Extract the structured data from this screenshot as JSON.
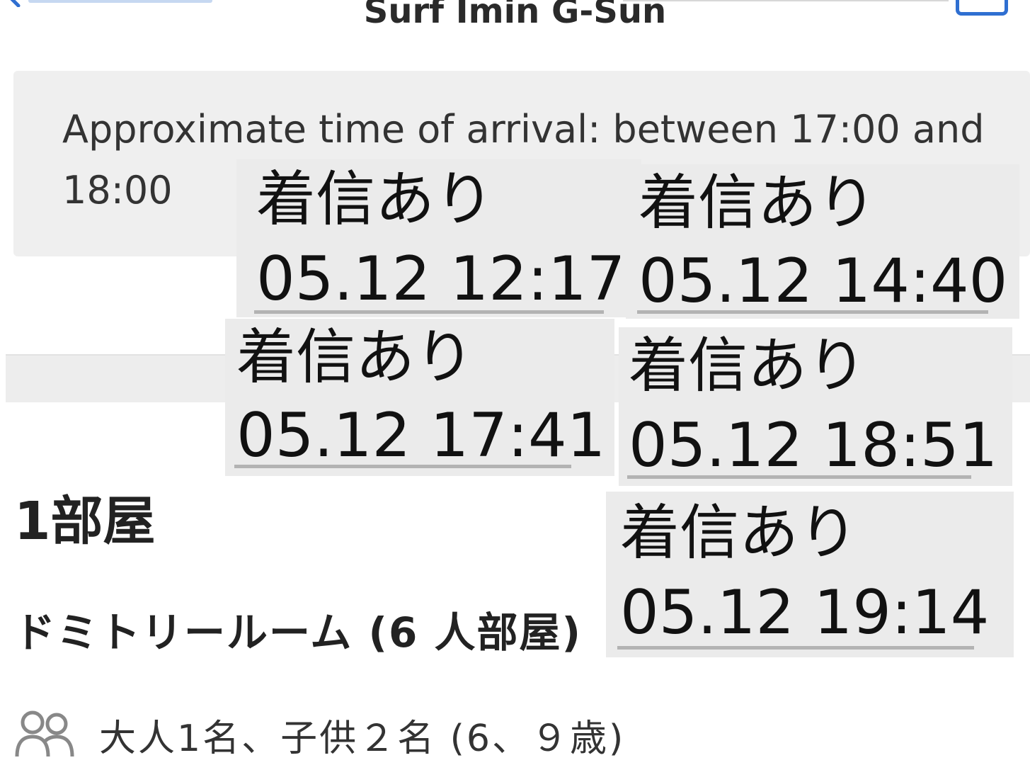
{
  "header": {
    "title": "Surf Imin G-Sun",
    "back_icon": "chevron-left-icon",
    "corner_icon": "compose-icon",
    "accent_color": "#2f6fd1"
  },
  "arrival": {
    "text": "Approximate time of arrival: between 17:00 and 18:00"
  },
  "room": {
    "count_label": "1部屋",
    "type_label": "ドミトリールーム (6 人部屋)",
    "guests_icon": "people-icon",
    "guests_label": "大人1名、子供２名 (6、９歳)"
  },
  "calls": [
    {
      "label": "着信あり",
      "time": "05.12 12:17"
    },
    {
      "label": "着信あり",
      "time": "05.12 14:40"
    },
    {
      "label": "着信あり",
      "time": "05.12 17:41"
    },
    {
      "label": "着信あり",
      "time": "05.12 18:51"
    },
    {
      "label": "着信あり",
      "time": "05.12 19:14"
    }
  ]
}
